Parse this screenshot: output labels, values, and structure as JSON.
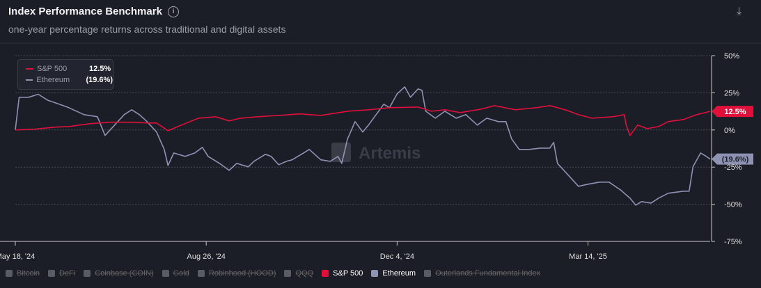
{
  "header": {
    "title": "Index Performance Benchmark",
    "info_icon": "i",
    "subtitle": "one-year percentage returns across traditional and digital assets",
    "download_icon": "⤓"
  },
  "watermark": "Artemis",
  "tooltip": [
    {
      "name": "S&P 500",
      "value": "12.5%",
      "color": "#e0103a"
    },
    {
      "name": "Ethereum",
      "value": "(19.6%)",
      "color": "#8f93b3"
    }
  ],
  "legend": [
    {
      "label": "Bitcoin",
      "active": false
    },
    {
      "label": "DeFi",
      "active": false
    },
    {
      "label": "Coinbase (COIN)",
      "active": false
    },
    {
      "label": "Gold",
      "active": false
    },
    {
      "label": "Robinhood (HOOD)",
      "active": false
    },
    {
      "label": "QQQ",
      "active": false
    },
    {
      "label": "S&P 500",
      "active": true,
      "color": "#e0103a"
    },
    {
      "label": "Ethereum",
      "active": true,
      "color": "#8f93b3"
    },
    {
      "label": "Outerlands Fundamental Index",
      "active": false
    }
  ],
  "chart_data": {
    "type": "line",
    "title": "Index Performance Benchmark",
    "x_unit": "days since May 18, 2024",
    "xlim": [
      0,
      364
    ],
    "ylim": [
      -75,
      50
    ],
    "y_ticks": [
      50,
      25,
      0,
      -25,
      -50,
      -75
    ],
    "y_tick_labels": [
      "50%",
      "25%",
      "0%",
      "-25%",
      "-50%",
      "-75%"
    ],
    "x_ticks": [
      0,
      100,
      200,
      300
    ],
    "x_tick_labels": [
      "May 18, '24",
      "Aug 26, '24",
      "Dec 4, '24",
      "Mar 14, '25"
    ],
    "end_labels": [
      "12.5%",
      "(19.6%)"
    ],
    "series": [
      {
        "name": "S&P 500",
        "color": "#e0103a",
        "points": [
          [
            0,
            0
          ],
          [
            10,
            0.5
          ],
          [
            21,
            1.9
          ],
          [
            28,
            2.3
          ],
          [
            39,
            4.2
          ],
          [
            50,
            5.2
          ],
          [
            61,
            5.2
          ],
          [
            69,
            4.7
          ],
          [
            74,
            4.7
          ],
          [
            80,
            -0.5
          ],
          [
            87,
            3.3
          ],
          [
            96,
            7.9
          ],
          [
            105,
            8.9
          ],
          [
            112,
            6.1
          ],
          [
            118,
            7.9
          ],
          [
            127,
            8.9
          ],
          [
            138,
            9.8
          ],
          [
            149,
            10.8
          ],
          [
            160,
            9.8
          ],
          [
            167,
            11.2
          ],
          [
            174,
            12.6
          ],
          [
            185,
            13.6
          ],
          [
            196,
            15
          ],
          [
            211,
            15.4
          ],
          [
            218,
            12.6
          ],
          [
            225,
            13.6
          ],
          [
            233,
            11.7
          ],
          [
            244,
            14
          ],
          [
            251,
            16.4
          ],
          [
            262,
            13.6
          ],
          [
            273,
            15
          ],
          [
            280,
            16.4
          ],
          [
            288,
            13.6
          ],
          [
            295,
            10.3
          ],
          [
            302,
            7.9
          ],
          [
            313,
            8.9
          ],
          [
            319,
            10.3
          ],
          [
            320,
            3.3
          ],
          [
            322,
            -3.7
          ],
          [
            326,
            3.3
          ],
          [
            331,
            0.9
          ],
          [
            337,
            2.3
          ],
          [
            342,
            5.6
          ],
          [
            350,
            7
          ],
          [
            357,
            10.3
          ],
          [
            364,
            12.5
          ]
        ]
      },
      {
        "name": "Ethereum",
        "color": "#8f93b3",
        "points": [
          [
            0,
            0
          ],
          [
            2,
            22
          ],
          [
            7,
            22
          ],
          [
            12,
            24
          ],
          [
            17,
            20
          ],
          [
            23,
            17.3
          ],
          [
            28,
            15
          ],
          [
            36,
            10.3
          ],
          [
            43,
            8.9
          ],
          [
            47,
            -3.7
          ],
          [
            52,
            3.3
          ],
          [
            57,
            10.3
          ],
          [
            61,
            13.6
          ],
          [
            65,
            10.3
          ],
          [
            69,
            5.6
          ],
          [
            74,
            -1.4
          ],
          [
            78,
            -13.1
          ],
          [
            80,
            -23.9
          ],
          [
            83,
            -15.5
          ],
          [
            89,
            -17.8
          ],
          [
            94,
            -15.5
          ],
          [
            98,
            -11.7
          ],
          [
            101,
            -17.8
          ],
          [
            107,
            -22.5
          ],
          [
            112,
            -27.2
          ],
          [
            116,
            -22.5
          ],
          [
            122,
            -24.8
          ],
          [
            125,
            -21.1
          ],
          [
            131,
            -16.4
          ],
          [
            134,
            -17.8
          ],
          [
            138,
            -23.4
          ],
          [
            142,
            -21.1
          ],
          [
            145,
            -20.1
          ],
          [
            151,
            -15.5
          ],
          [
            154,
            -13.1
          ],
          [
            160,
            -20.1
          ],
          [
            165,
            -21.1
          ],
          [
            169,
            -17.8
          ],
          [
            171,
            -22.5
          ],
          [
            174,
            -6.1
          ],
          [
            178,
            5.6
          ],
          [
            182,
            -1.4
          ],
          [
            185,
            3.3
          ],
          [
            189,
            10.3
          ],
          [
            193,
            17.3
          ],
          [
            196,
            15
          ],
          [
            200,
            24.3
          ],
          [
            204,
            29
          ],
          [
            207,
            22
          ],
          [
            211,
            27.6
          ],
          [
            213,
            26.7
          ],
          [
            215,
            12.6
          ],
          [
            220,
            7.9
          ],
          [
            225,
            12.6
          ],
          [
            231,
            7.9
          ],
          [
            236,
            10.3
          ],
          [
            242,
            3.3
          ],
          [
            247,
            7.9
          ],
          [
            253,
            5.6
          ],
          [
            257,
            5.6
          ],
          [
            260,
            -6.1
          ],
          [
            264,
            -13.1
          ],
          [
            269,
            -13.1
          ],
          [
            275,
            -12.2
          ],
          [
            280,
            -12.2
          ],
          [
            282,
            -8.4
          ],
          [
            284,
            -22.5
          ],
          [
            289,
            -29.5
          ],
          [
            295,
            -37.9
          ],
          [
            300,
            -36.5
          ],
          [
            306,
            -35.1
          ],
          [
            311,
            -35.1
          ],
          [
            317,
            -40.3
          ],
          [
            322,
            -45.9
          ],
          [
            325,
            -50.6
          ],
          [
            328,
            -48.2
          ],
          [
            333,
            -49.2
          ],
          [
            337,
            -45.9
          ],
          [
            342,
            -42.6
          ],
          [
            350,
            -41.2
          ],
          [
            353,
            -41.2
          ],
          [
            355,
            -24.8
          ],
          [
            359,
            -15.5
          ],
          [
            362,
            -17.8
          ],
          [
            364,
            -19.6
          ]
        ]
      }
    ]
  }
}
